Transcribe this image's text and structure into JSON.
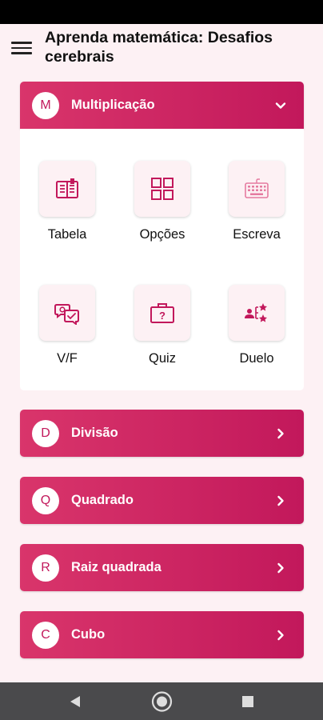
{
  "app": {
    "title": "Aprenda matemática: Desafios cerebrais"
  },
  "colors": {
    "accent": "#c2185b",
    "accent_light": "#d9356b",
    "background": "#fdf1f4",
    "card": "#ffffff",
    "nav_bar": "#4a4a4c"
  },
  "sections": [
    {
      "letter": "M",
      "label": "Multiplicação",
      "expanded": true,
      "arrow": "chevron-down-icon"
    },
    {
      "letter": "D",
      "label": "Divisão",
      "expanded": false,
      "arrow": "chevron-right-icon"
    },
    {
      "letter": "Q",
      "label": "Quadrado",
      "expanded": false,
      "arrow": "chevron-right-icon"
    },
    {
      "letter": "R",
      "label": "Raiz quadrada",
      "expanded": false,
      "arrow": "chevron-right-icon"
    },
    {
      "letter": "C",
      "label": "Cubo",
      "expanded": false,
      "arrow": "chevron-right-icon"
    }
  ],
  "modes": [
    {
      "label": "Tabela",
      "icon": "book-icon"
    },
    {
      "label": "Opções",
      "icon": "grid-icon"
    },
    {
      "label": "Escreva",
      "icon": "keyboard-icon"
    },
    {
      "label": "V/F",
      "icon": "true-false-icon"
    },
    {
      "label": "Quiz",
      "icon": "quiz-icon"
    },
    {
      "label": "Duelo",
      "icon": "duel-icon"
    }
  ],
  "system_nav": {
    "back": "back-icon",
    "home": "home-icon",
    "recents": "recents-icon"
  }
}
